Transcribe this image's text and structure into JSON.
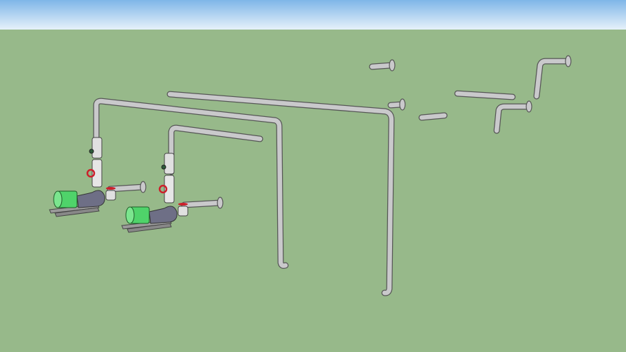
{
  "scene": {
    "colors": {
      "sky_top": "#7fb6e8",
      "sky_horizon": "#e6f1fa",
      "ground": "#97b98a",
      "pipe": "#c9c9cb",
      "pipe_edge": "#555555",
      "motor": "#4fd36a",
      "pump_body": "#6e6f86",
      "valve_handle": "#cc1f2a"
    }
  }
}
